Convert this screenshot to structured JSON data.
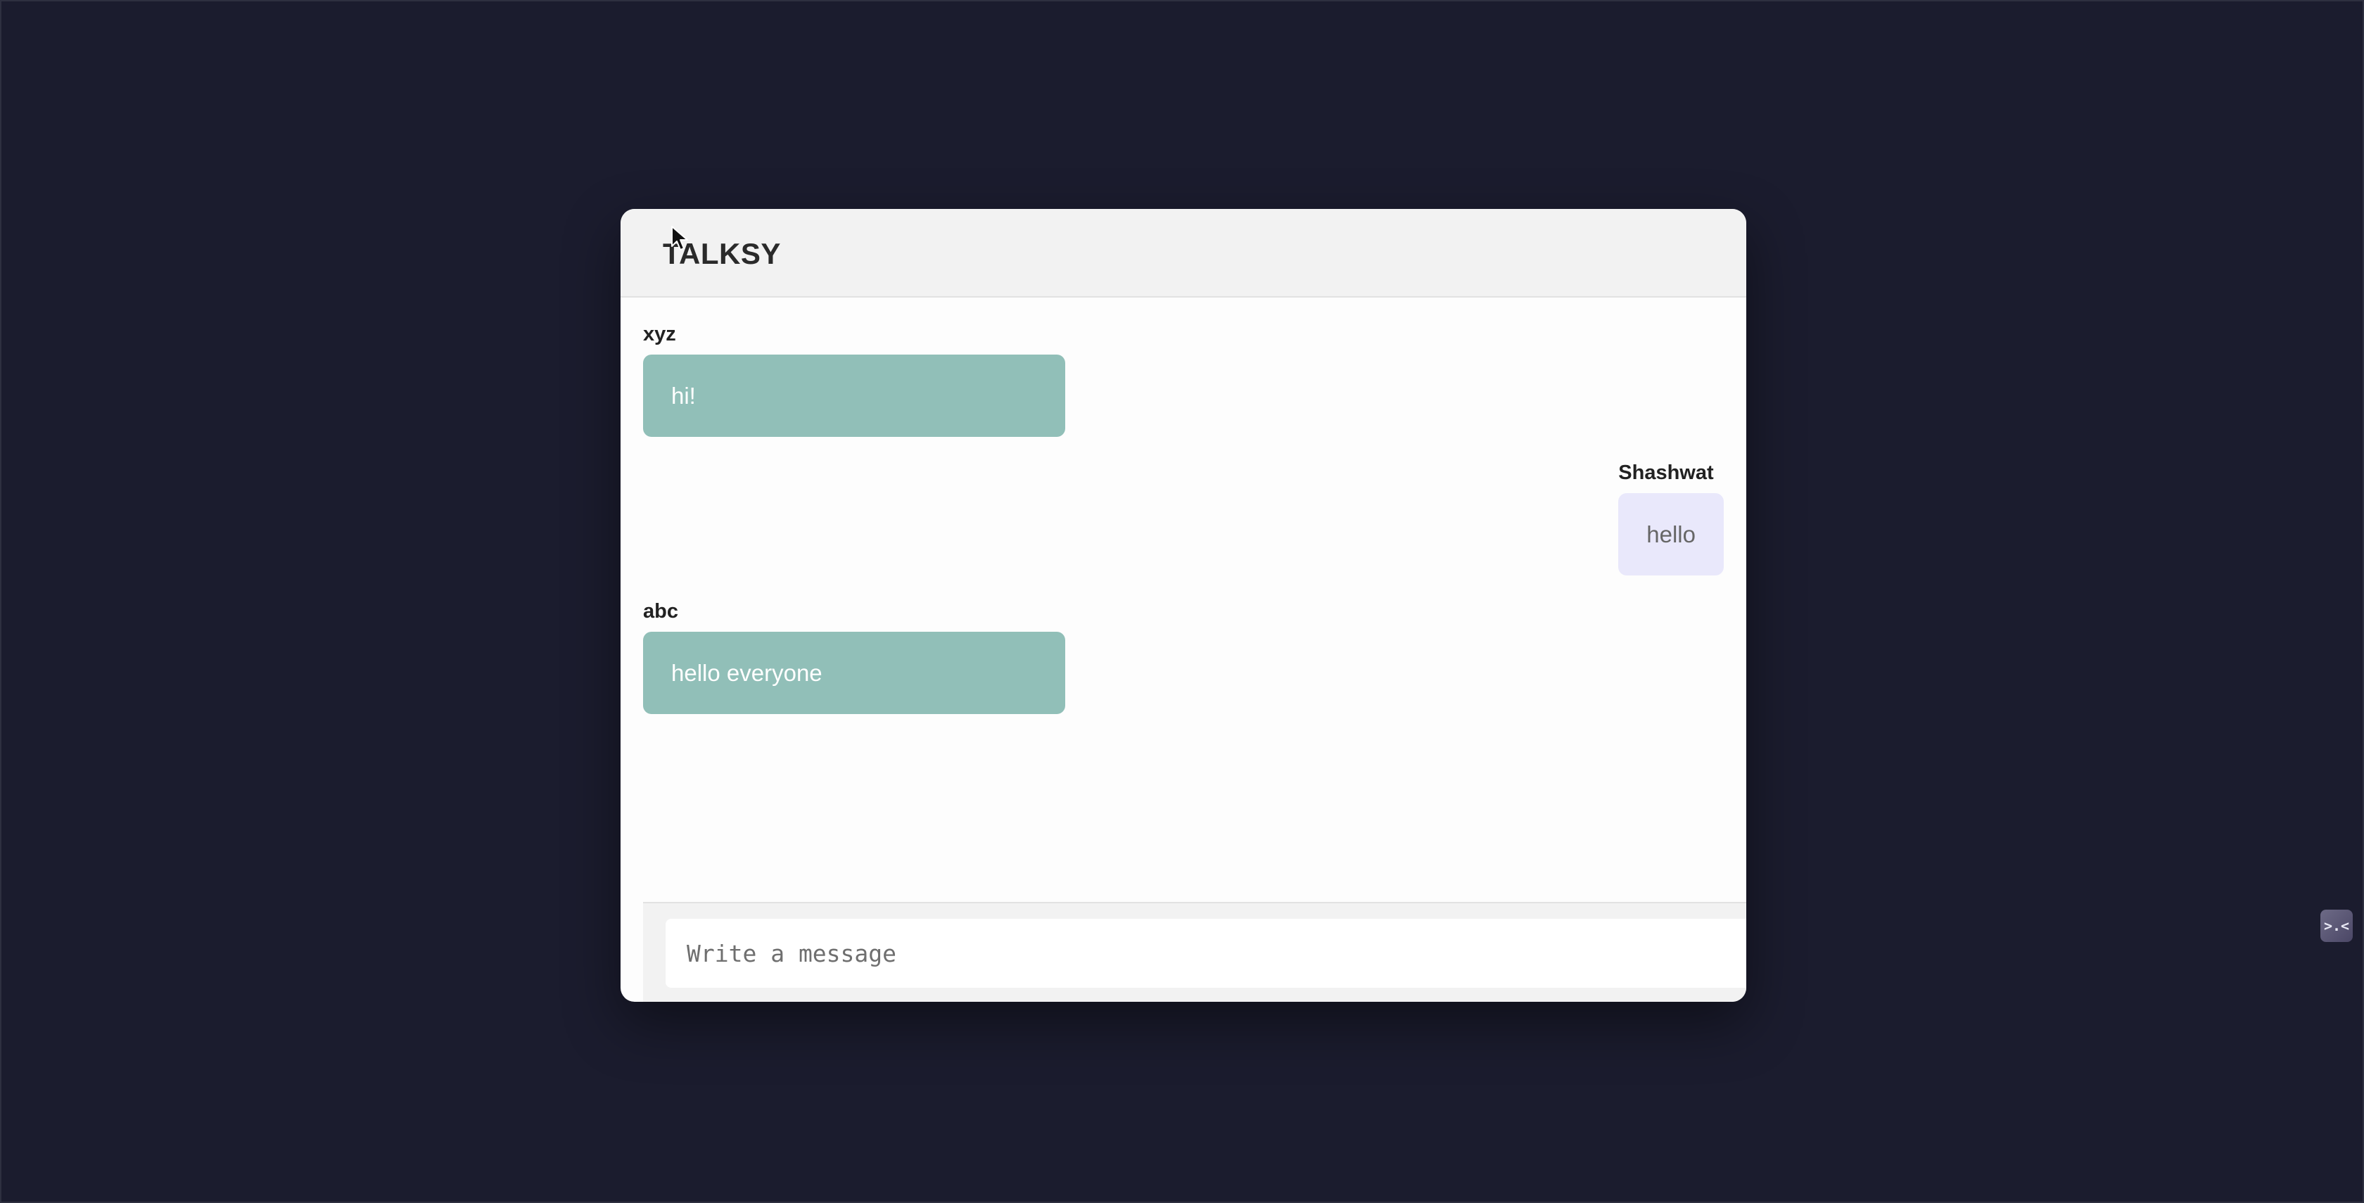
{
  "app": {
    "title": "TALKSY"
  },
  "messages": [
    {
      "sender": "xyz",
      "text": "hi!",
      "side": "other"
    },
    {
      "sender": "Shashwat",
      "text": "hello",
      "side": "self"
    },
    {
      "sender": "abc",
      "text": "hello everyone",
      "side": "other"
    }
  ],
  "composer": {
    "placeholder": "Write a message",
    "value": ""
  },
  "widget": {
    "icon": "terminal-face-icon",
    "glyph": ">.<"
  },
  "colors": {
    "background": "#1b1c2e",
    "other_bubble": "#91bfb8",
    "self_bubble": "#e9e8fb",
    "header": "#f2f2f2"
  }
}
